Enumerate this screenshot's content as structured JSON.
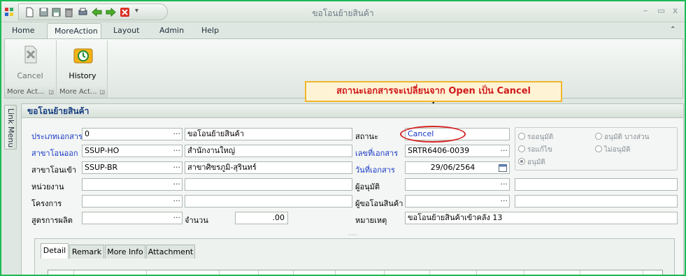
{
  "window": {
    "title": "ขอโอนย้ายสินค้า",
    "min": "–",
    "max": "▭",
    "close": "x"
  },
  "menu": {
    "home": "Home",
    "moreaction": "MoreAction",
    "layout": "Layout",
    "admin": "Admin",
    "help": "Help",
    "collapse": "⌃"
  },
  "ribbon": {
    "cancel_label": "Cancel",
    "history_label": "History",
    "group1_footer": "More Act...",
    "group2_footer": "More Act..."
  },
  "callout": {
    "text": "สถานะเอกสารจะเปลี่ยนจาก Open เป็น Cancel"
  },
  "link_menu": "Link Menu",
  "panel": {
    "title": "ขอโอนย้ายสินค้า"
  },
  "form": {
    "doc_type_label": "ประเภทเอกสาร",
    "doc_type_code": "0",
    "doc_type_name": "ขอโอนย้ายสินค้า",
    "branch_out_label": "สาขาโอนออก",
    "branch_out_code": "SSUP-HO",
    "branch_out_name": "สำนักงานใหญ่",
    "branch_in_label": "สาขาโอนเข้า",
    "branch_in_code": "SSUP-BR",
    "branch_in_name": "สาขาศิขรภูมิ-สุรินทร์",
    "unit_label": "หน่วยงาน",
    "unit_code": "",
    "unit_name": "",
    "project_label": "โครงการ",
    "project_code": "",
    "project_name": "",
    "formula_label": "สูตรการผลิต",
    "formula_code": "",
    "qty_label": "จำนวน",
    "qty_value": ".00",
    "status_label": "สถานะ",
    "status_value": "Cancel",
    "doc_no_label": "เลขที่เอกสาร",
    "doc_no_value": "SRTR6406-0039",
    "doc_date_label": "วันที่เอกสาร",
    "doc_date_value": "29/06/2564",
    "approver_label": "ผู้อนุมัติ",
    "approver_value": "",
    "requester_label": "ผู้ขอโอนสินค้า",
    "requester_value": "",
    "remark_label": "หมายเหตุ",
    "remark_value": "ขอโอนย้ายสินค้าเข้าคลัง 13",
    "dots": "···"
  },
  "approval": {
    "waiting": "รออนุมัติ",
    "partial": "อนุมัติ บางส่วน",
    "waiting_fix": "รอแก้ไข",
    "not_approved": "ไม่อนุมัติ",
    "approved": "อนุมัติ",
    "selected": "approved"
  },
  "detail_tabs": [
    "Detail",
    "Remark",
    "More Info",
    "Attachment"
  ],
  "colors": {
    "frame": "#1db954",
    "blue_label": "#1736c6",
    "callout_text": "#d01a1a",
    "callout_border": "#f0b62d"
  }
}
